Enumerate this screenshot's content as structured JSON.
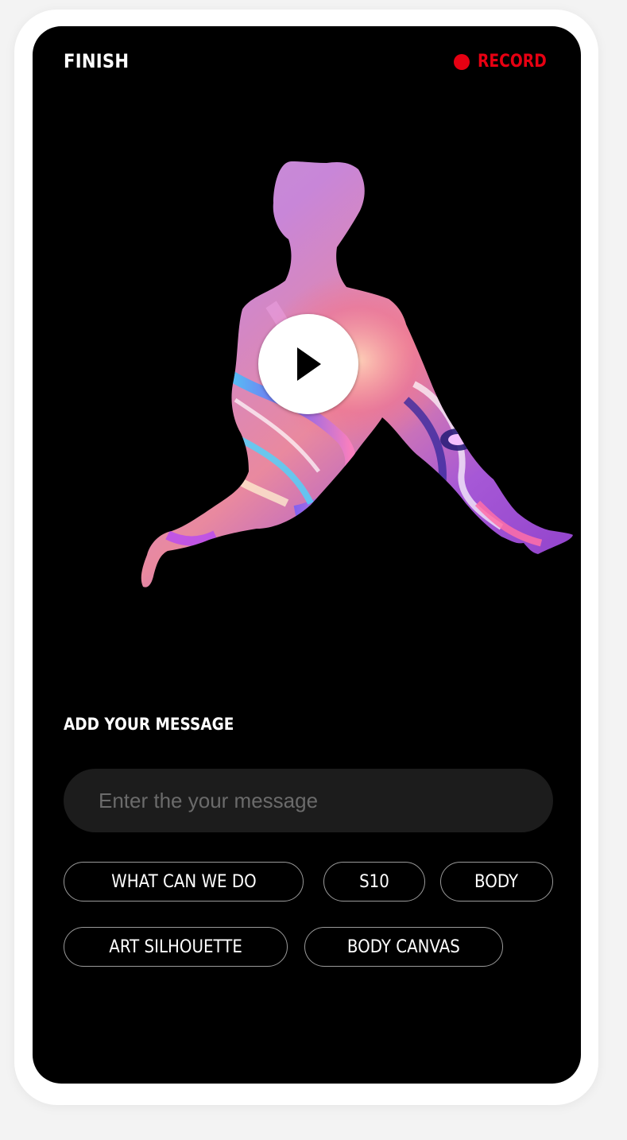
{
  "header": {
    "finish_label": "FINISH",
    "record_label": "RECORD"
  },
  "media": {
    "play_icon": "play-icon"
  },
  "message": {
    "heading": "ADD YOUR MESSAGE",
    "placeholder": "Enter the your message",
    "value": ""
  },
  "suggestions": [
    "WHAT CAN WE DO",
    "S10",
    "BODY",
    "ART SILHOUETTE",
    "BODY CANVAS"
  ],
  "colors": {
    "background": "#000000",
    "accent_record": "#e60012",
    "chip_border": "#9a9a9a",
    "input_background": "#1c1c1c"
  }
}
